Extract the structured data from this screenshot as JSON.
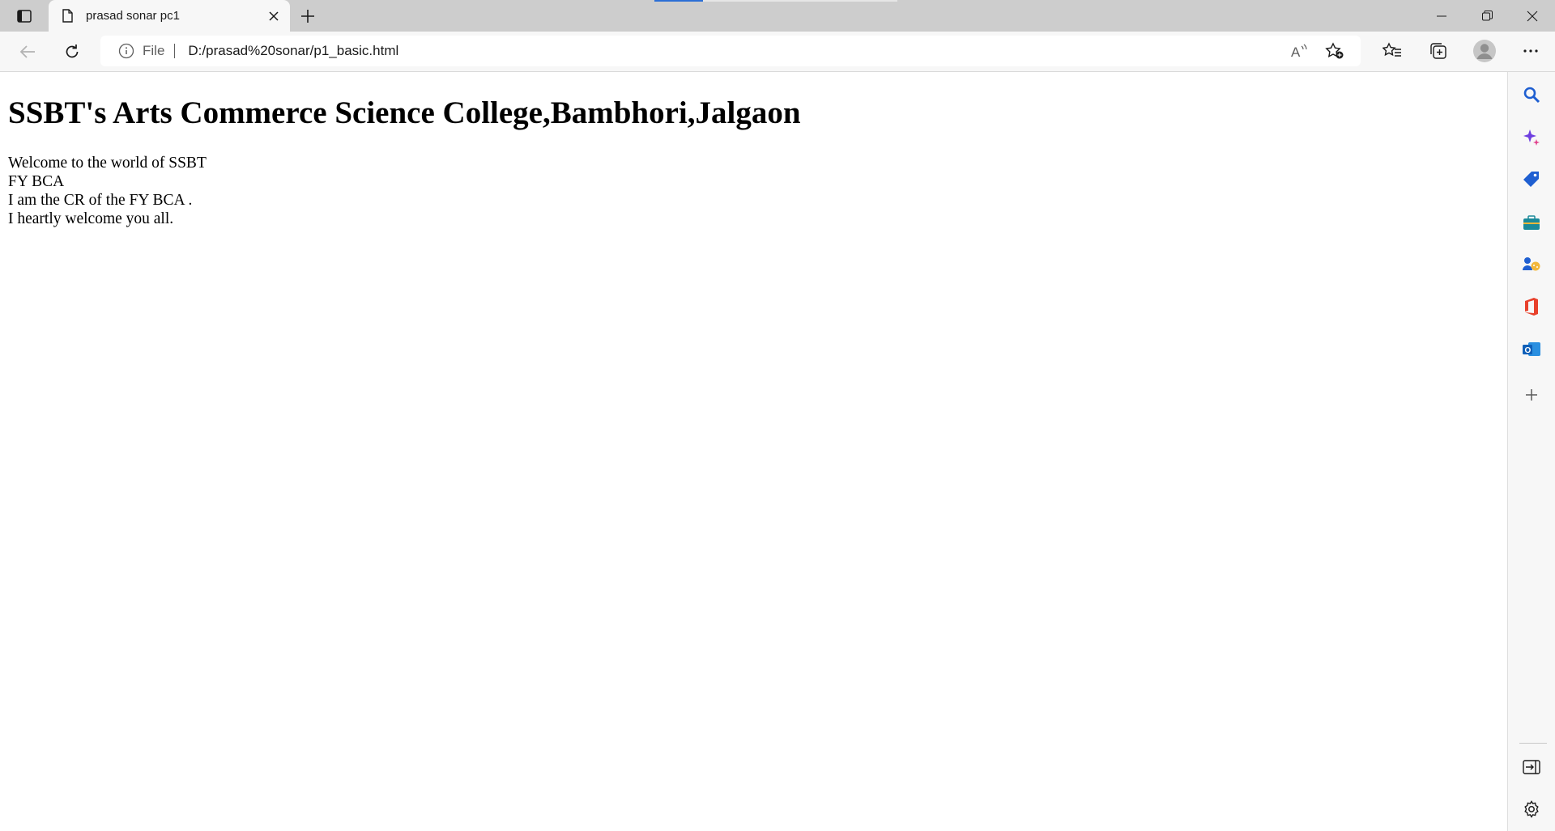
{
  "browser": {
    "tab": {
      "title": "prasad sonar pc1"
    },
    "address": {
      "scheme": "File",
      "url": "D:/prasad%20sonar/p1_basic.html"
    }
  },
  "page": {
    "heading": "SSBT's Arts Commerce Science College,Bambhori,Jalgaon",
    "lines": [
      "Welcome to the world of SSBT",
      "FY BCA",
      "I am the CR of the FY BCA .",
      "I heartly welcome you all."
    ]
  },
  "icons": {
    "tab_actions": "tab-actions-icon",
    "favicon": "document-icon",
    "close": "close-icon",
    "new_tab": "plus-icon",
    "back": "back-arrow-icon",
    "refresh": "refresh-icon",
    "info": "info-icon",
    "read_aloud": "read-aloud-icon",
    "add_favorite": "star-plus-icon",
    "favorites": "favorites-icon",
    "collections": "collections-icon",
    "profile": "profile-avatar-icon",
    "more": "more-options-icon",
    "sidebar": [
      "search-icon",
      "copilot-icon",
      "shopping-icon",
      "tools-icon",
      "games-icon",
      "office-icon",
      "outlook-icon",
      "add-icon",
      "hide-sidebar-icon",
      "settings-icon"
    ]
  },
  "colors": {
    "accent": "#2b6fd6",
    "titlebar": "#cdcdcd",
    "toolbar": "#f7f7f7"
  }
}
